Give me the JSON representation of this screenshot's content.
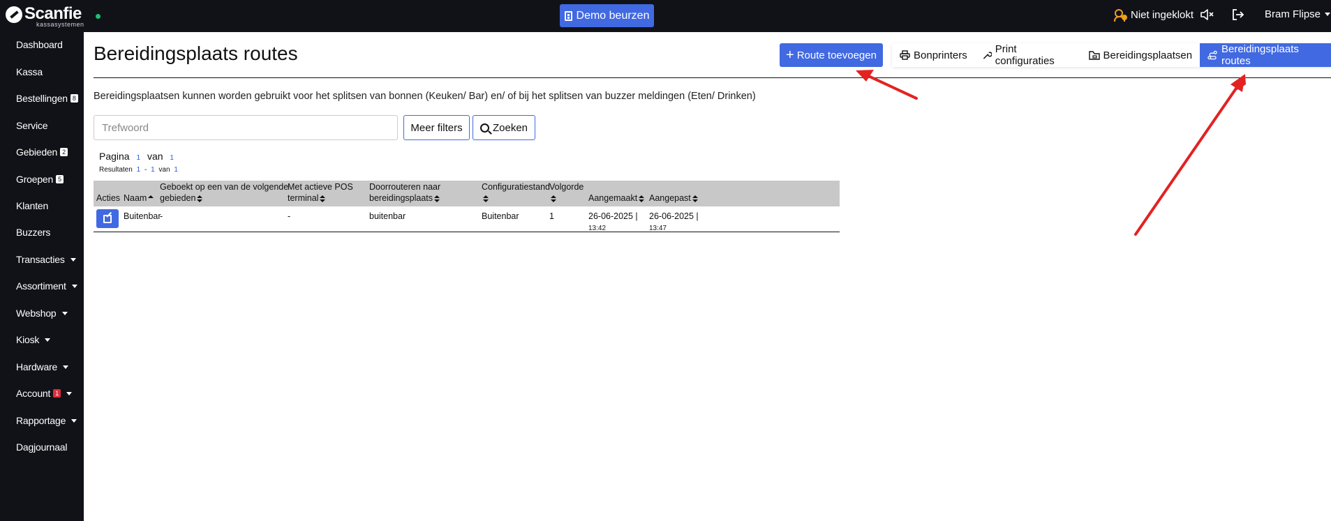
{
  "topbar": {
    "logo_text": "Scanfie",
    "logo_subtitle": "kassasystemen",
    "demo_button": "Demo beurzen",
    "clock_status": "Niet ingeklokt",
    "user_name": "Bram Flipse"
  },
  "sidebar": {
    "items": [
      {
        "label": "Dashboard"
      },
      {
        "label": "Kassa"
      },
      {
        "label": "Bestellingen",
        "badge": "8"
      },
      {
        "label": "Service"
      },
      {
        "label": "Gebieden",
        "badge": "2"
      },
      {
        "label": "Groepen",
        "badge": "5"
      },
      {
        "label": "Klanten"
      },
      {
        "label": "Buzzers"
      },
      {
        "label": "Transacties"
      },
      {
        "label": "Assortiment"
      },
      {
        "label": "Webshop"
      },
      {
        "label": "Kiosk"
      },
      {
        "label": "Hardware"
      },
      {
        "label": "Account",
        "badge": "1"
      },
      {
        "label": "Rapportage"
      },
      {
        "label": "Dagjournaal"
      }
    ]
  },
  "page": {
    "title": "Bereidingsplaats routes",
    "add_button": "Route toevoegen",
    "tabs": [
      {
        "label": "Bonprinters"
      },
      {
        "label": "Print configuraties"
      },
      {
        "label": "Bereidingsplaatsen"
      },
      {
        "label": "Bereidingsplaats routes"
      }
    ],
    "intro": "Bereidingsplaatsen kunnen worden gebruikt voor het splitsen van bonnen (Keuken/ Bar) en/ of bij het splitsen van buzzer meldingen (Eten/ Drinken)"
  },
  "search": {
    "placeholder": "Trefwoord",
    "more_filters": "Meer filters",
    "search_button": "Zoeken"
  },
  "pagination": {
    "page_label": "Pagina",
    "page_current": "1",
    "of_label": "van",
    "page_total": "1",
    "results_label": "Resultaten",
    "results_from": "1",
    "dash": "-",
    "results_to": "1",
    "results_total": "1"
  },
  "table": {
    "headers": {
      "actions": "Acties",
      "name": "Naam",
      "booked_line1": "Geboekt op een van de volgende",
      "booked_line2": "gebieden",
      "pos_line1": "Met actieve POS",
      "pos_line2": "terminal",
      "reroute_line1": "Doorrouteren naar",
      "reroute_line2": "bereidingsplaats",
      "config": "Configuratiestand",
      "order": "Volgorde",
      "created": "Aangemaakt",
      "modified": "Aangepast"
    },
    "rows": [
      {
        "name": "Buitenbar",
        "booked": "-",
        "pos": "-",
        "reroute": "buitenbar",
        "config": "Buitenbar",
        "order": "1",
        "created_date": "26-06-2025 |",
        "created_time": "13:42",
        "modified_date": "26-06-2025 |",
        "modified_time": "13:47"
      }
    ]
  },
  "colors": {
    "accent": "#4169e1",
    "dark": "#111218",
    "annotation_arrow": "#e32222"
  }
}
